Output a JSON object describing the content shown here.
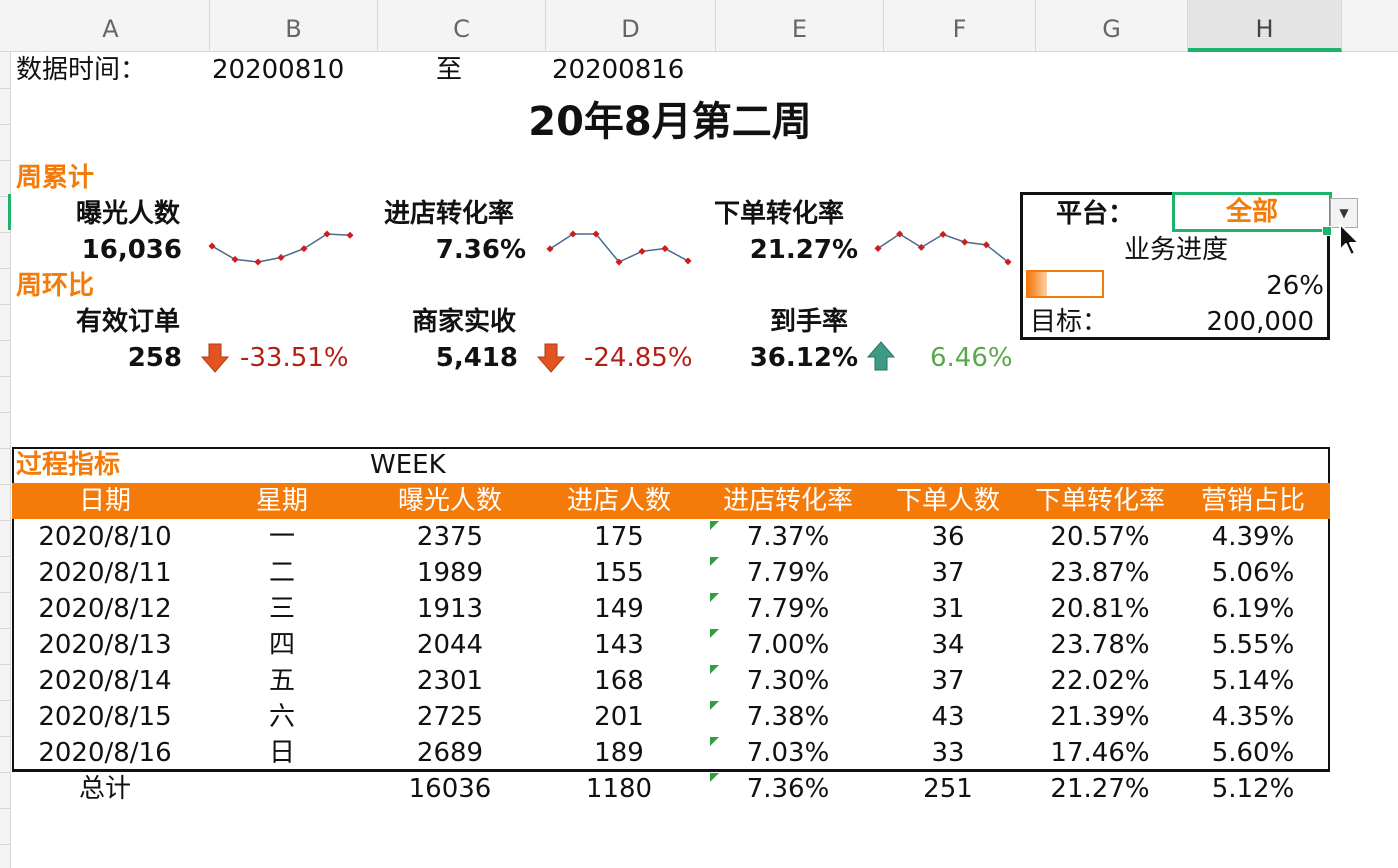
{
  "columns": [
    "A",
    "B",
    "C",
    "D",
    "E",
    "F",
    "G",
    "H"
  ],
  "selected_column": "H",
  "header_row": {
    "data_time_label": "数据时间：",
    "start_date": "20200810",
    "to_label": "至",
    "end_date": "20200816"
  },
  "report_title": "20年8月第二周",
  "weekly_cumulative": {
    "section_label": "周累计",
    "metrics": [
      {
        "label": "曝光人数",
        "value": "16,036",
        "sparkline": [
          2375,
          1989,
          1913,
          2044,
          2301,
          2725,
          2689
        ]
      },
      {
        "label": "进店转化率",
        "value": "7.36%",
        "sparkline": [
          7.37,
          7.79,
          7.79,
          7.0,
          7.3,
          7.38,
          7.03
        ]
      },
      {
        "label": "下单转化率",
        "value": "21.27%",
        "sparkline": [
          20.57,
          23.87,
          20.81,
          23.78,
          22.02,
          21.39,
          17.46
        ]
      }
    ]
  },
  "week_over_week": {
    "section_label": "周环比",
    "metrics": [
      {
        "label": "有效订单",
        "value": "258",
        "change": "-33.51%",
        "direction": "down"
      },
      {
        "label": "商家实收",
        "value": "5,418",
        "change": "-24.85%",
        "direction": "down"
      },
      {
        "label": "到手率",
        "value": "36.12%",
        "change": "6.46%",
        "direction": "up"
      }
    ]
  },
  "panel": {
    "platform_label": "平台：",
    "platform_value": "全部",
    "progress_label": "业务进度",
    "progress_fraction": 0.26,
    "progress_text": "26%",
    "target_label": "目标：",
    "target_value": "200,000"
  },
  "process_table": {
    "section_label": "过程指标",
    "week_label": "WEEK",
    "headers": [
      "日期",
      "星期",
      "曝光人数",
      "进店人数",
      "进店转化率",
      "下单人数",
      "下单转化率",
      "营销占比"
    ],
    "rows": [
      [
        "2020/8/10",
        "一",
        "2375",
        "175",
        "7.37%",
        "36",
        "20.57%",
        "4.39%"
      ],
      [
        "2020/8/11",
        "二",
        "1989",
        "155",
        "7.79%",
        "37",
        "23.87%",
        "5.06%"
      ],
      [
        "2020/8/12",
        "三",
        "1913",
        "149",
        "7.79%",
        "31",
        "20.81%",
        "6.19%"
      ],
      [
        "2020/8/13",
        "四",
        "2044",
        "143",
        "7.00%",
        "34",
        "23.78%",
        "5.55%"
      ],
      [
        "2020/8/14",
        "五",
        "2301",
        "168",
        "7.30%",
        "37",
        "22.02%",
        "5.14%"
      ],
      [
        "2020/8/15",
        "六",
        "2725",
        "201",
        "7.38%",
        "43",
        "21.39%",
        "4.35%"
      ],
      [
        "2020/8/16",
        "日",
        "2689",
        "189",
        "7.03%",
        "33",
        "17.46%",
        "5.60%"
      ]
    ],
    "total_row": [
      "总计",
      "",
      "16036",
      "1180",
      "7.36%",
      "251",
      "21.27%",
      "5.12%"
    ]
  },
  "colors": {
    "accent": "#f47a0a",
    "negative": "#b31f16",
    "positive": "#5aa84a",
    "selection": "#1db36b",
    "sparkline_line": "#4a6a8a",
    "sparkline_point": "#d11c1c"
  }
}
